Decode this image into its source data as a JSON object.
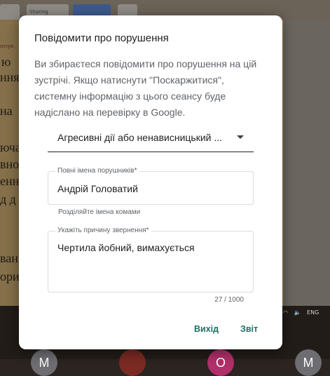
{
  "background": {
    "tabs": [
      "",
      "Sharing",
      "",
      ""
    ],
    "doc_fragments": [
      "ю",
      "ння",
      "на",
      "юча",
      "вно",
      "енн",
      "д д",
      "ван",
      "ори"
    ],
    "doc_header_fragment": "итери",
    "tray_language": "ENG",
    "avatars": [
      "M",
      "",
      "О",
      "M"
    ]
  },
  "dialog": {
    "title": "Повідомити про порушення",
    "description": "Ви збираєтеся повідомити про порушення на цій зустрічі. Якщо натиснути \"Поскаржитися\", системну інформацію з цього сеансу буде надіслано на перевірку в Google.",
    "category_select": {
      "value": "Агресивні дії або ненависницький ..."
    },
    "names_field": {
      "label": "Повні імена порушників*",
      "value": "Андрій Головатий",
      "hint": "Розділяйте імена комами"
    },
    "reason_field": {
      "label": "Укажіть причину звернення*",
      "value": "Чертила йобний, вимахується",
      "counter": "27 / 1000"
    },
    "buttons": {
      "cancel": "Вихід",
      "submit": "Звіт"
    }
  },
  "colors": {
    "accent": "#1a7266",
    "text_primary": "#202124",
    "text_secondary": "#5f6368",
    "border": "#dadce0"
  }
}
